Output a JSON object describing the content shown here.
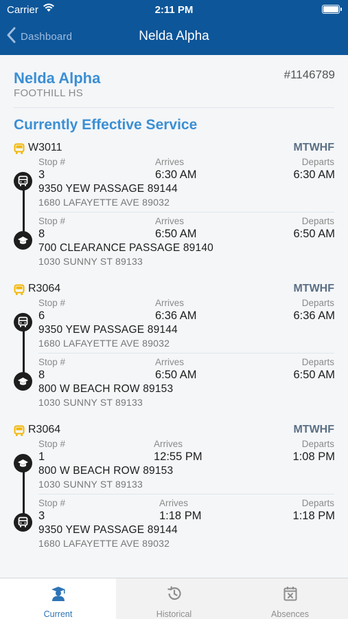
{
  "status_bar": {
    "carrier": "Carrier",
    "time": "2:11 PM"
  },
  "nav": {
    "back_label": "Dashboard",
    "title": "Nelda Alpha"
  },
  "student": {
    "name": "Nelda Alpha",
    "school": "FOOTHILL HS",
    "id": "#1146789"
  },
  "section_title": "Currently Effective Service",
  "colors": {
    "header": "#0d5699",
    "accent": "#3b8fd4",
    "bus_icon": "#f2b705",
    "active_tab": "#2d74b6"
  },
  "routes": [
    {
      "name": "W3011",
      "days": "MTWHF",
      "stops": [
        {
          "icon": "bus-stop-icon",
          "stop_label": "Stop #",
          "stop": "3",
          "arrives_label": "Arrives",
          "arrives": "6:30 AM",
          "departs_label": "Departs",
          "departs": "6:30 AM",
          "address": "9350 YEW PASSAGE 89144",
          "cross": "1680 LAFAYETTE AVE 89032"
        },
        {
          "icon": "school-icon",
          "stop_label": "Stop #",
          "stop": "8",
          "arrives_label": "Arrives",
          "arrives": "6:50 AM",
          "departs_label": "Departs",
          "departs": "6:50 AM",
          "address": "700 CLEARANCE PASSAGE 89140",
          "cross": "1030 SUNNY ST 89133"
        }
      ]
    },
    {
      "name": "R3064",
      "days": "MTWHF",
      "stops": [
        {
          "icon": "bus-stop-icon",
          "stop_label": "Stop #",
          "stop": "6",
          "arrives_label": "Arrives",
          "arrives": "6:36 AM",
          "departs_label": "Departs",
          "departs": "6:36 AM",
          "address": "9350 YEW PASSAGE 89144",
          "cross": "1680 LAFAYETTE AVE 89032"
        },
        {
          "icon": "school-icon",
          "stop_label": "Stop #",
          "stop": "8",
          "arrives_label": "Arrives",
          "arrives": "6:50 AM",
          "departs_label": "Departs",
          "departs": "6:50 AM",
          "address": "800 W BEACH ROW 89153",
          "cross": "1030 SUNNY ST 89133"
        }
      ]
    },
    {
      "name": "R3064",
      "days": "MTWHF",
      "stops": [
        {
          "icon": "school-icon",
          "stop_label": "Stop #",
          "stop": "1",
          "arrives_label": "Arrives",
          "arrives": "12:55 PM",
          "departs_label": "Departs",
          "departs": "1:08 PM",
          "address": "800 W BEACH ROW 89153",
          "cross": "1030 SUNNY ST 89133"
        },
        {
          "icon": "bus-stop-icon",
          "stop_label": "Stop #",
          "stop": "3",
          "arrives_label": "Arrives",
          "arrives": "1:18 PM",
          "departs_label": "Departs",
          "departs": "1:18 PM",
          "address": "9350 YEW PASSAGE 89144",
          "cross": "1680 LAFAYETTE AVE 89032"
        }
      ]
    }
  ],
  "tabs": [
    {
      "label": "Current",
      "icon": "student-icon",
      "active": true
    },
    {
      "label": "Historical",
      "icon": "history-icon",
      "active": false
    },
    {
      "label": "Absences",
      "icon": "calendar-x-icon",
      "active": false
    }
  ]
}
